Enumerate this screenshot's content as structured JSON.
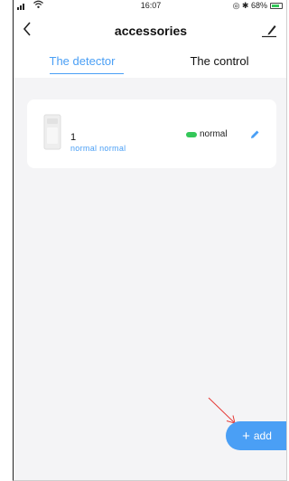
{
  "status_bar": {
    "time": "16:07",
    "battery_text": "◎ ✱ 68%"
  },
  "nav": {
    "title": "accessories",
    "back_icon": "chevron-left-icon",
    "edit_icon": "edit-icon"
  },
  "tabs": [
    {
      "label": "The detector",
      "active": true
    },
    {
      "label": "The control",
      "active": false
    }
  ],
  "devices": [
    {
      "name": "1",
      "subtitle": "normal normal",
      "status": "normal"
    }
  ],
  "add_button": {
    "label": "add"
  },
  "colors": {
    "accent": "#4a9ff5",
    "status_ok": "#34c759",
    "annotation_arrow": "#e53935",
    "background": "#f4f4f6"
  }
}
